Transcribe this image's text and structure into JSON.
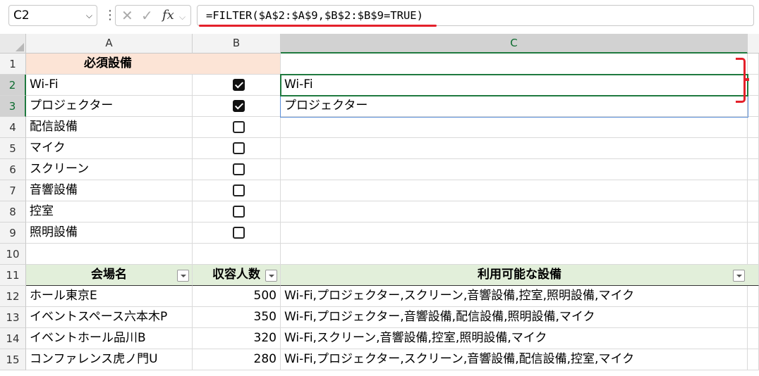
{
  "formula_bar": {
    "name_box": "C2",
    "formula": "=FILTER($A$2:$A$9,$B$2:$B$9=TRUE)",
    "fx_label": "fx"
  },
  "columns": [
    "A",
    "B",
    "C"
  ],
  "rows": [
    "1",
    "2",
    "3",
    "4",
    "5",
    "6",
    "7",
    "8",
    "9",
    "10",
    "11",
    "12",
    "13",
    "14",
    "15"
  ],
  "equipment_header": "必須設備",
  "equipment": [
    {
      "name": "Wi-Fi",
      "checked": true
    },
    {
      "name": "プロジェクター",
      "checked": true
    },
    {
      "name": "配信設備",
      "checked": false
    },
    {
      "name": "マイク",
      "checked": false
    },
    {
      "name": "スクリーン",
      "checked": false
    },
    {
      "name": "音響設備",
      "checked": false
    },
    {
      "name": "控室",
      "checked": false
    },
    {
      "name": "照明設備",
      "checked": false
    }
  ],
  "filter_result": [
    "Wi-Fi",
    "プロジェクター"
  ],
  "table": {
    "headers": [
      "会場名",
      "収容人数",
      "利用可能な設備"
    ],
    "rows": [
      [
        "ホール東京E",
        "500",
        "Wi-Fi,プロジェクター,スクリーン,音響設備,控室,照明設備,マイク"
      ],
      [
        "イベントスペース六本木P",
        "350",
        "Wi-Fi,プロジェクター,音響設備,配信設備,照明設備,マイク"
      ],
      [
        "イベントホール品川B",
        "320",
        "Wi-Fi,スクリーン,音響設備,控室,照明設備,マイク"
      ],
      [
        "コンファレンス虎ノ門U",
        "280",
        "Wi-Fi,プロジェクター,スクリーン,音響設備,配信設備,控室,マイク"
      ]
    ]
  },
  "colors": {
    "selection": "#1f7a3f",
    "annotation": "#e4202a",
    "header_pink": "#fce4d6",
    "header_green": "#e2efda"
  }
}
